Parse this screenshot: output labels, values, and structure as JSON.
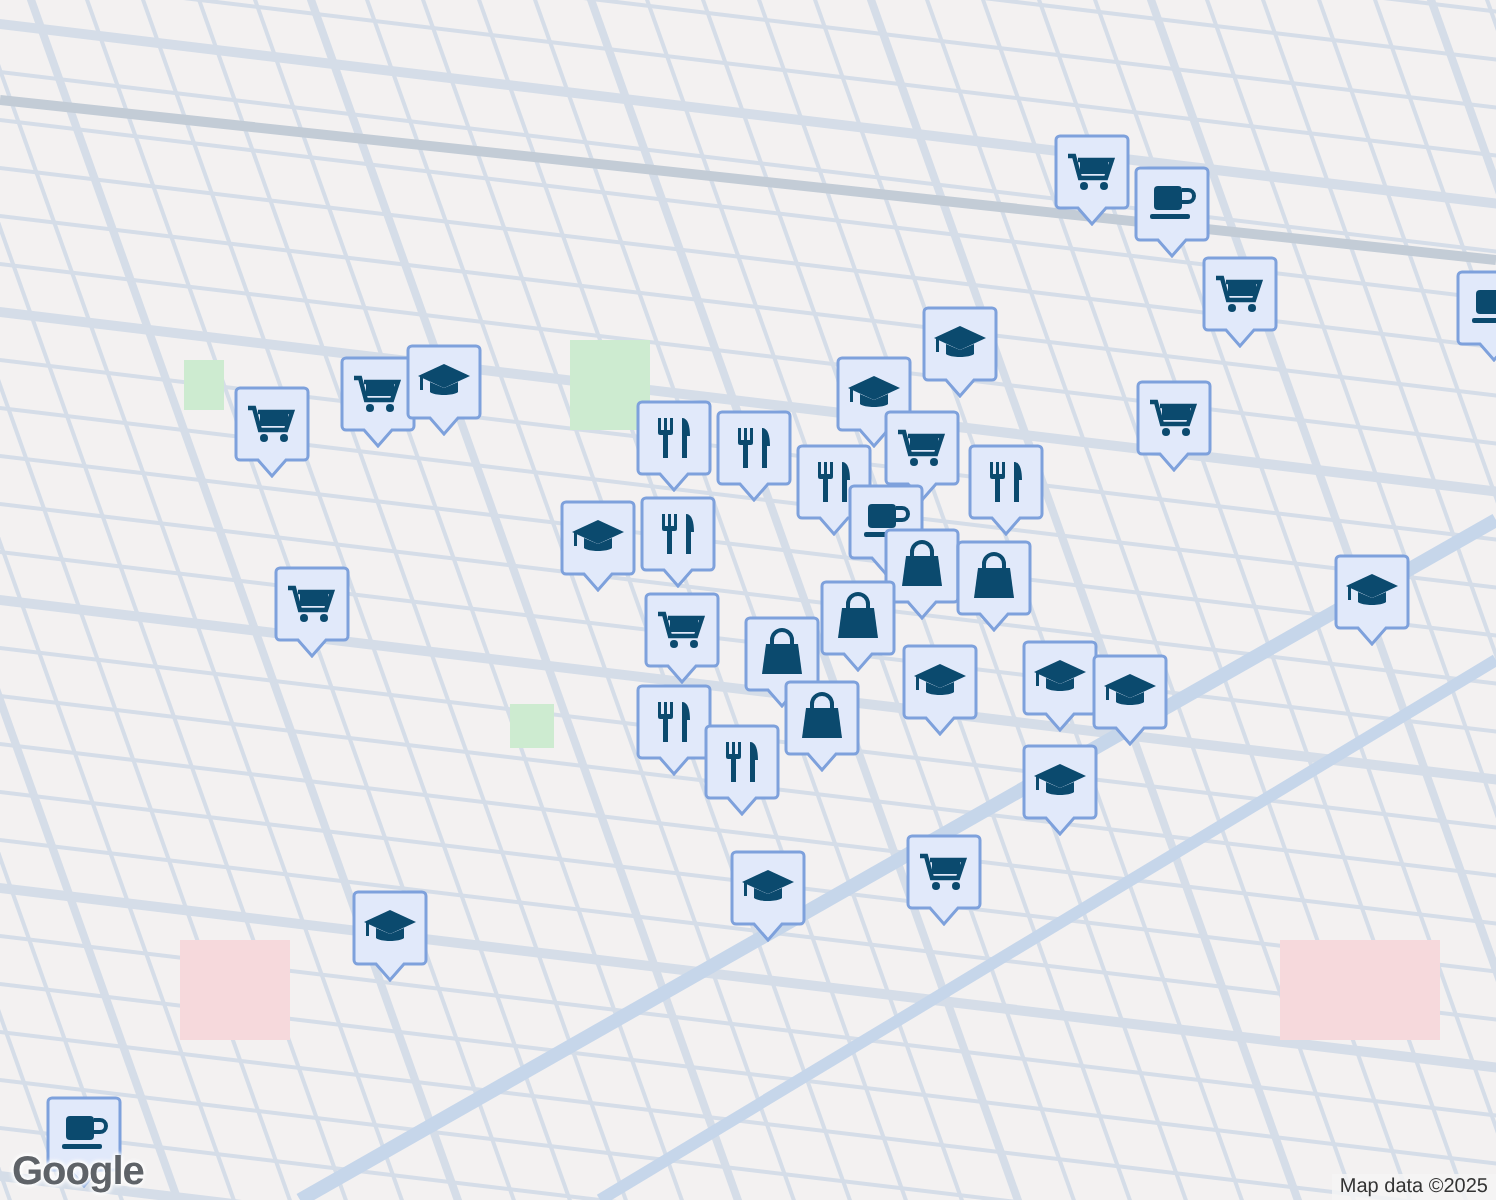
{
  "map": {
    "pins": [
      {
        "kind": "cart"
      },
      {
        "kind": "cup"
      },
      {
        "kind": "cart"
      },
      {
        "kind": "cup"
      },
      {
        "kind": "grad"
      },
      {
        "kind": "grad"
      },
      {
        "kind": "cart"
      },
      {
        "kind": "cart"
      },
      {
        "kind": "cart"
      },
      {
        "kind": "cart"
      },
      {
        "kind": "grad"
      },
      {
        "kind": "food"
      },
      {
        "kind": "food"
      },
      {
        "kind": "food"
      },
      {
        "kind": "food"
      },
      {
        "kind": "grad"
      },
      {
        "kind": "cart"
      },
      {
        "kind": "cup"
      },
      {
        "kind": "food"
      },
      {
        "kind": "bag"
      },
      {
        "kind": "bag"
      },
      {
        "kind": "bag"
      },
      {
        "kind": "grad"
      },
      {
        "kind": "cart"
      },
      {
        "kind": "bag"
      },
      {
        "kind": "bag"
      },
      {
        "kind": "food"
      },
      {
        "kind": "food"
      },
      {
        "kind": "grad"
      },
      {
        "kind": "grad"
      },
      {
        "kind": "grad"
      },
      {
        "kind": "grad"
      },
      {
        "kind": "cart"
      },
      {
        "kind": "grad"
      },
      {
        "kind": "grad"
      },
      {
        "kind": "cup"
      }
    ]
  },
  "logo": "Google",
  "attribution": "Map data ©2025"
}
